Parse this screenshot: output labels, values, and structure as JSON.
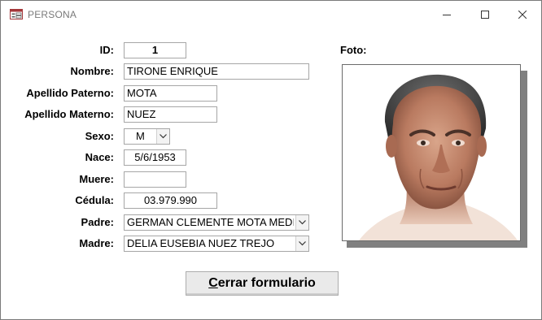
{
  "window": {
    "title": "PERSONA"
  },
  "form": {
    "id_label": "ID:",
    "id_value": "1",
    "nombre_label": "Nombre:",
    "nombre_value": "TIRONE ENRIQUE",
    "apellido_paterno_label": "Apellido Paterno:",
    "apellido_paterno_value": "MOTA",
    "apellido_materno_label": "Apellido Materno:",
    "apellido_materno_value": "NUEZ",
    "sexo_label": "Sexo:",
    "sexo_value": "M",
    "nace_label": "Nace:",
    "nace_value": "5/6/1953",
    "muere_label": "Muere:",
    "muere_value": "",
    "cedula_label": "Cédula:",
    "cedula_value": "03.979.990",
    "padre_label": "Padre:",
    "padre_value": "GERMAN CLEMENTE MOTA MEDIN",
    "madre_label": "Madre:",
    "madre_value": "DELIA EUSEBIA NUEZ TREJO",
    "foto_label": "Foto:"
  },
  "actions": {
    "close_button_mnemonic": "C",
    "close_button_rest": "errar formulario"
  },
  "icons": {
    "app": "form-icon",
    "minimize": "minimize-icon",
    "maximize": "maximize-icon",
    "close": "close-icon",
    "dropdown": "chevron-down-icon"
  }
}
